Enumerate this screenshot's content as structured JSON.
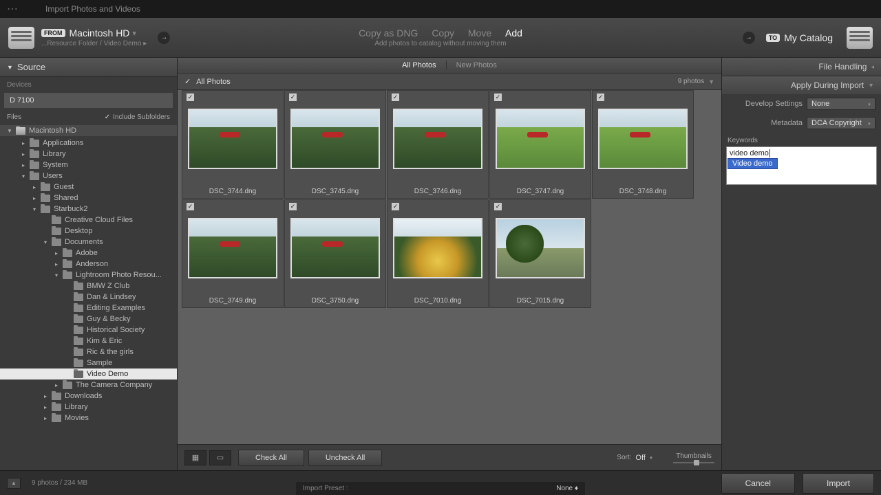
{
  "window": {
    "title": "Import Photos and Videos"
  },
  "topbar": {
    "from_badge": "FROM",
    "from_title": "Macintosh HD",
    "from_path": "...Resource Folder / Video Demo ▸",
    "modes": {
      "copy_dng": "Copy as DNG",
      "copy": "Copy",
      "move": "Move",
      "add": "Add"
    },
    "mode_sub": "Add photos to catalog without moving them",
    "to_badge": "TO",
    "to_title": "My Catalog"
  },
  "source": {
    "header": "Source",
    "devices_label": "Devices",
    "device": "D 7100",
    "files_label": "Files",
    "include_subfolders": "Include Subfolders",
    "root": "Macintosh HD",
    "tree": [
      {
        "d": 1,
        "t": "Applications",
        "a": "▸"
      },
      {
        "d": 1,
        "t": "Library",
        "a": "▸"
      },
      {
        "d": 1,
        "t": "System",
        "a": "▸"
      },
      {
        "d": 1,
        "t": "Users",
        "a": "▾"
      },
      {
        "d": 2,
        "t": "Guest",
        "a": "▸"
      },
      {
        "d": 2,
        "t": "Shared",
        "a": "▸"
      },
      {
        "d": 2,
        "t": "Starbuck2",
        "a": "▾"
      },
      {
        "d": 3,
        "t": "Creative Cloud Files",
        "a": ""
      },
      {
        "d": 3,
        "t": "Desktop",
        "a": ""
      },
      {
        "d": 3,
        "t": "Documents",
        "a": "▾"
      },
      {
        "d": 4,
        "t": "Adobe",
        "a": "▸"
      },
      {
        "d": 4,
        "t": "Anderson",
        "a": "▸"
      },
      {
        "d": 4,
        "t": "Lightroom Photo Resou...",
        "a": "▾"
      },
      {
        "d": 5,
        "t": "BMW Z Club",
        "a": ""
      },
      {
        "d": 5,
        "t": "Dan & Lindsey",
        "a": ""
      },
      {
        "d": 5,
        "t": "Editing Examples",
        "a": ""
      },
      {
        "d": 5,
        "t": "Guy & Becky",
        "a": ""
      },
      {
        "d": 5,
        "t": "Historical Society",
        "a": ""
      },
      {
        "d": 5,
        "t": "Kim & Eric",
        "a": ""
      },
      {
        "d": 5,
        "t": "Ric & the girls",
        "a": ""
      },
      {
        "d": 5,
        "t": "Sample",
        "a": ""
      },
      {
        "d": 5,
        "t": "Video Demo",
        "a": "",
        "sel": true
      },
      {
        "d": 4,
        "t": "The Camera Company",
        "a": "▸"
      },
      {
        "d": 3,
        "t": "Downloads",
        "a": "▸"
      },
      {
        "d": 3,
        "t": "Library",
        "a": "▸"
      },
      {
        "d": 3,
        "t": "Movies",
        "a": "▸"
      }
    ]
  },
  "grid": {
    "tabs": {
      "all": "All Photos",
      "new": "New Photos"
    },
    "title": "All Photos",
    "count": "9 photos",
    "items": [
      {
        "f": "DSC_3744.dng",
        "v": "plane"
      },
      {
        "f": "DSC_3745.dng",
        "v": "plane"
      },
      {
        "f": "DSC_3746.dng",
        "v": "plane"
      },
      {
        "f": "DSC_3747.dng",
        "v": "bright"
      },
      {
        "f": "DSC_3748.dng",
        "v": "bright"
      },
      {
        "f": "DSC_3749.dng",
        "v": "plane"
      },
      {
        "f": "DSC_3750.dng",
        "v": "plane"
      },
      {
        "f": "DSC_7010.dng",
        "v": "autumn"
      },
      {
        "f": "DSC_7015.dng",
        "v": "landscape"
      }
    ],
    "check_all": "Check All",
    "uncheck_all": "Uncheck All",
    "sort_label": "Sort:",
    "sort_value": "Off",
    "thumb_label": "Thumbnails"
  },
  "right": {
    "file_handling": "File Handling",
    "apply_during": "Apply During Import",
    "develop_label": "Develop Settings",
    "develop_value": "None",
    "metadata_label": "Metadata",
    "metadata_value": "DCA Copyright",
    "keywords_label": "Keywords",
    "keywords_input": "video demo",
    "keywords_suggest": "Video demo"
  },
  "footer": {
    "stats": "9 photos / 234 MB",
    "preset_label": "Import Preset :",
    "preset_value": "None",
    "cancel": "Cancel",
    "import": "Import"
  }
}
